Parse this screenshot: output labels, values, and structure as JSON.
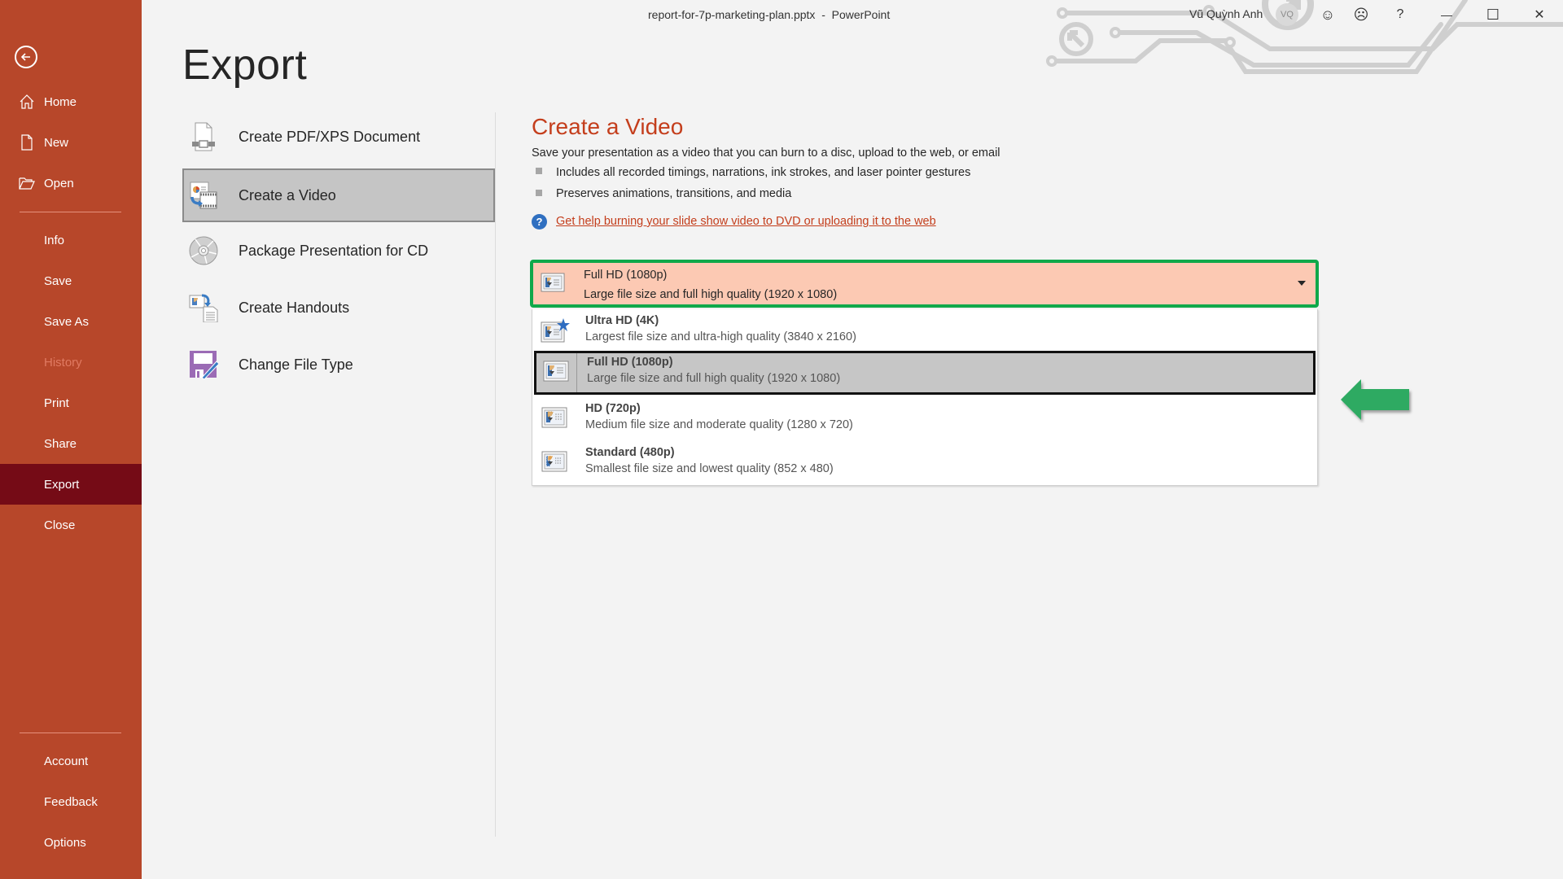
{
  "window": {
    "title": "report-for-7p-marketing-plan.pptx  -  PowerPoint",
    "user_name": "Vũ Quỳnh Anh",
    "user_initials": "VQ",
    "controls": {
      "smile": "☺",
      "frown": "☹",
      "help": "?",
      "minimize": "—",
      "maximize": "☐",
      "close": "✕"
    }
  },
  "sidebar": {
    "back_label": "Back",
    "items": [
      {
        "label": "Home",
        "icon": "home-icon"
      },
      {
        "label": "New",
        "icon": "new-document-icon"
      },
      {
        "label": "Open",
        "icon": "folder-open-icon"
      },
      {
        "label": "Info"
      },
      {
        "label": "Save"
      },
      {
        "label": "Save As"
      },
      {
        "label": "History",
        "disabled": true
      },
      {
        "label": "Print"
      },
      {
        "label": "Share"
      },
      {
        "label": "Export",
        "active": true
      },
      {
        "label": "Close"
      }
    ],
    "bottom_items": [
      {
        "label": "Account"
      },
      {
        "label": "Feedback"
      },
      {
        "label": "Options"
      }
    ],
    "colors": {
      "background": "#b7472a",
      "active": "#750b16",
      "disabled_text": "#e07a62"
    }
  },
  "page": {
    "title": "Export"
  },
  "export_options": [
    {
      "label": "Create PDF/XPS Document",
      "icon": "pdf-document-icon"
    },
    {
      "label": "Create a Video",
      "icon": "create-video-icon",
      "selected": true
    },
    {
      "label": "Package Presentation for CD",
      "icon": "cd-disc-icon"
    },
    {
      "label": "Create Handouts",
      "icon": "handouts-icon"
    },
    {
      "label": "Change File Type",
      "icon": "change-file-type-icon"
    }
  ],
  "video_panel": {
    "title": "Create a Video",
    "description": "Save your presentation as a video that you can burn to a disc, upload to the web, or email",
    "bullets": [
      "Includes all recorded timings, narrations, ink strokes, and laser pointer gestures",
      "Preserves animations, transitions, and media"
    ],
    "help_link": "Get help burning your slide show video to DVD or uploading it to the web",
    "quality_dropdown": {
      "selected_title": "Full HD (1080p)",
      "selected_desc": "Large file size and full high quality (1920 x 1080)",
      "options": [
        {
          "title": "Ultra HD (4K)",
          "desc": "Largest file size and ultra-high quality (3840 x 2160)"
        },
        {
          "title": "Full HD (1080p)",
          "desc": "Large file size and full high quality (1920 x 1080)",
          "highlighted": true
        },
        {
          "title": "HD (720p)",
          "desc": "Medium file size and moderate quality (1280 x 720)"
        },
        {
          "title": "Standard (480p)",
          "desc": "Smallest file size and lowest quality (852 x 480)"
        }
      ]
    },
    "colors": {
      "title": "#c43e1c",
      "dropdown_bg": "#fcc9b3",
      "dropdown_border": "#0fa84a",
      "annotation_arrow": "#2eaa62"
    }
  }
}
